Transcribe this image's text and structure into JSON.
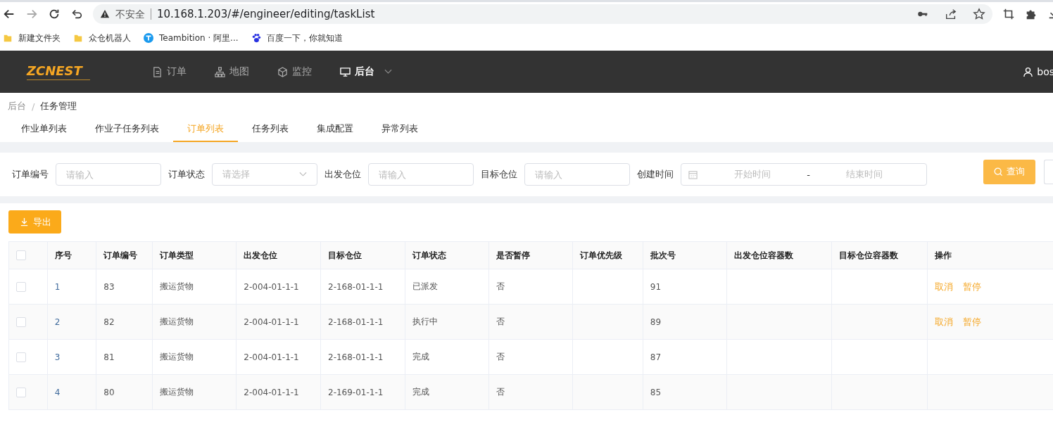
{
  "browser": {
    "security_label": "不安全",
    "url": "10.168.1.203/#/engineer/editing/taskList",
    "bookmarks": [
      {
        "kind": "folder",
        "label": "新建文件夹"
      },
      {
        "kind": "folder",
        "label": "众仓机器人"
      },
      {
        "kind": "teambition",
        "label": "Teambition · 阿里..."
      },
      {
        "kind": "baidu",
        "label": "百度一下，你就知道"
      }
    ]
  },
  "header": {
    "logo": "ZCNEST",
    "nav": [
      {
        "kind": "doc",
        "label": "订单",
        "selected": false
      },
      {
        "kind": "map",
        "label": "地图",
        "selected": false
      },
      {
        "kind": "cube",
        "label": "监控",
        "selected": false
      },
      {
        "kind": "monitor",
        "label": "后台",
        "selected": true
      }
    ],
    "user": "bos"
  },
  "breadcrumb": [
    "后台",
    "任务管理"
  ],
  "breadcrumb_separator": "/",
  "tabs": [
    {
      "label": "作业单列表",
      "selected": false
    },
    {
      "label": "作业子任务列表",
      "selected": false
    },
    {
      "label": "订单列表",
      "selected": true
    },
    {
      "label": "任务列表",
      "selected": false
    },
    {
      "label": "集成配置",
      "selected": false
    },
    {
      "label": "异常列表",
      "selected": false
    }
  ],
  "filters": [
    {
      "kind": "input",
      "label": "订单编号",
      "placeholder": "请输入"
    },
    {
      "kind": "select",
      "label": "订单状态",
      "placeholder": "请选择"
    },
    {
      "kind": "input",
      "label": "出发仓位",
      "placeholder": "请输入"
    },
    {
      "kind": "input",
      "label": "目标仓位",
      "placeholder": "请输入"
    },
    {
      "kind": "daterange",
      "label": "创建时间",
      "start_placeholder": "开始时间",
      "separator": "-",
      "end_placeholder": "结束时间"
    }
  ],
  "search_button": "查询",
  "export_button": "导出",
  "table": {
    "all_checked": false,
    "columns": [
      "序号",
      "订单编号",
      "订单类型",
      "出发仓位",
      "目标仓位",
      "订单状态",
      "是否暂停",
      "订单优先级",
      "批次号",
      "出发仓位容器数",
      "目标仓位容器数",
      "操作"
    ],
    "rows": [
      {
        "checked": false,
        "cells": [
          "1",
          "83",
          "搬运货物",
          "2-004-01-1-1",
          "2-168-01-1-1",
          "已派发",
          "否",
          "",
          "91",
          "",
          ""
        ],
        "actions": [
          "取消",
          "暂停"
        ]
      },
      {
        "checked": false,
        "cells": [
          "2",
          "82",
          "搬运货物",
          "2-004-01-1-1",
          "2-168-01-1-1",
          "执行中",
          "否",
          "",
          "89",
          "",
          ""
        ],
        "actions": [
          "取消",
          "暂停"
        ]
      },
      {
        "checked": false,
        "cells": [
          "3",
          "81",
          "搬运货物",
          "2-004-01-1-1",
          "2-168-01-1-1",
          "完成",
          "否",
          "",
          "87",
          "",
          ""
        ],
        "actions": []
      },
      {
        "checked": false,
        "cells": [
          "4",
          "80",
          "搬运货物",
          "2-004-01-1-1",
          "2-169-01-1-1",
          "完成",
          "否",
          "",
          "85",
          "",
          ""
        ],
        "actions": []
      }
    ]
  }
}
